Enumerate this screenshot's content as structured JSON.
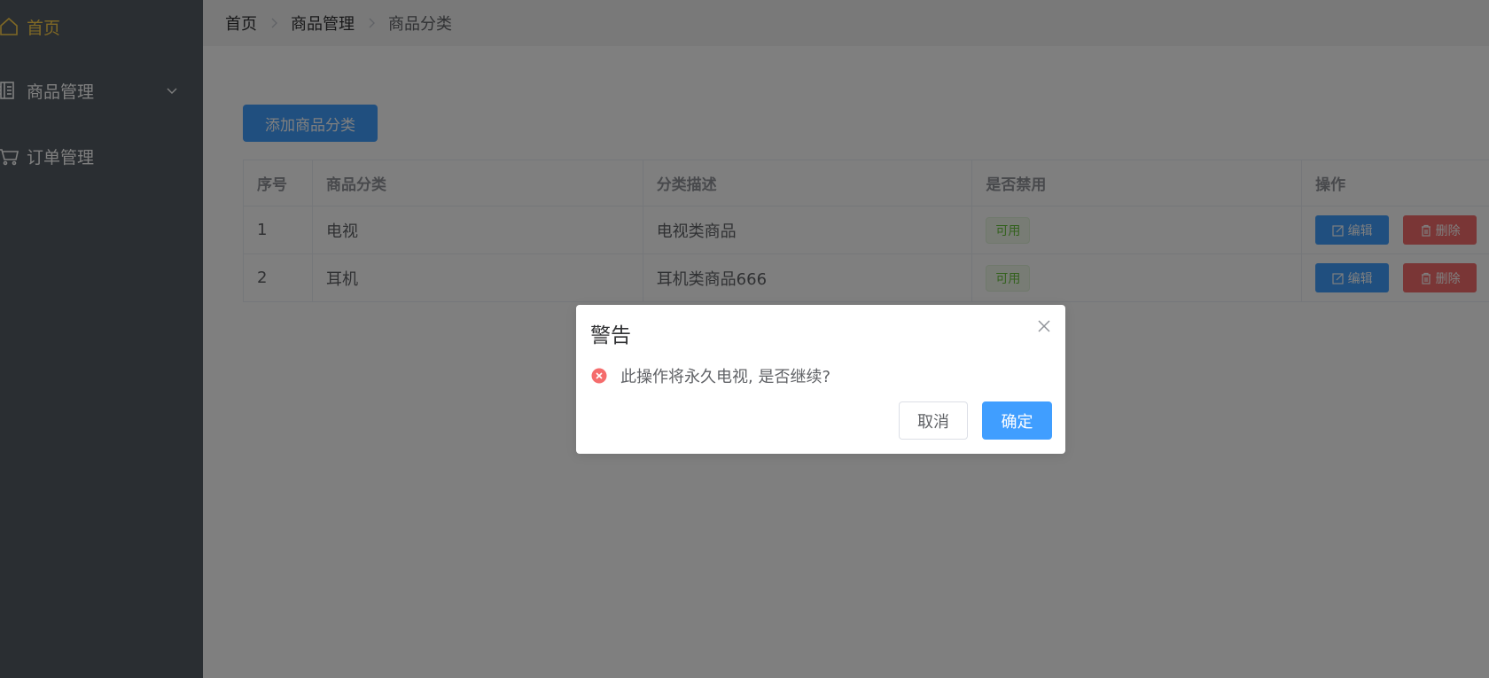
{
  "colors": {
    "sidebar_bg": "#545c64",
    "sidebar_active_text": "#ffd04b",
    "primary": "#409eff",
    "danger": "#f56c6c",
    "success": "#67c23a",
    "overlay": "rgba(0,0,0,0.5)"
  },
  "sidebar": {
    "items": [
      {
        "label": "首页",
        "icon": "home-icon",
        "active": true
      },
      {
        "label": "商品管理",
        "icon": "document-icon",
        "expandable": true,
        "arrow_icon": "chevron-down-icon"
      },
      {
        "label": "订单管理",
        "icon": "cart-icon"
      }
    ]
  },
  "breadcrumb": {
    "items": [
      "首页",
      "商品管理",
      "商品分类"
    ],
    "separator_icon": "chevron-right-icon"
  },
  "main": {
    "add_button_label": "添加商品分类",
    "table": {
      "columns": [
        "序号",
        "商品分类",
        "分类描述",
        "是否禁用",
        "操作"
      ],
      "rows": [
        {
          "index": "1",
          "category": "电视",
          "description": "电视类商品",
          "status": "可用",
          "edit_label": "编辑",
          "delete_label": "删除"
        },
        {
          "index": "2",
          "category": "耳机",
          "description": "耳机类商品666",
          "status": "可用",
          "edit_label": "编辑",
          "delete_label": "删除"
        }
      ],
      "edit_icon": "edit-icon",
      "delete_icon": "trash-icon"
    }
  },
  "dialog": {
    "title": "警告",
    "message": "此操作将永久电视, 是否继续?",
    "status_icon": "error-circle-icon",
    "close_icon": "close-icon",
    "cancel_label": "取消",
    "confirm_label": "确定"
  }
}
